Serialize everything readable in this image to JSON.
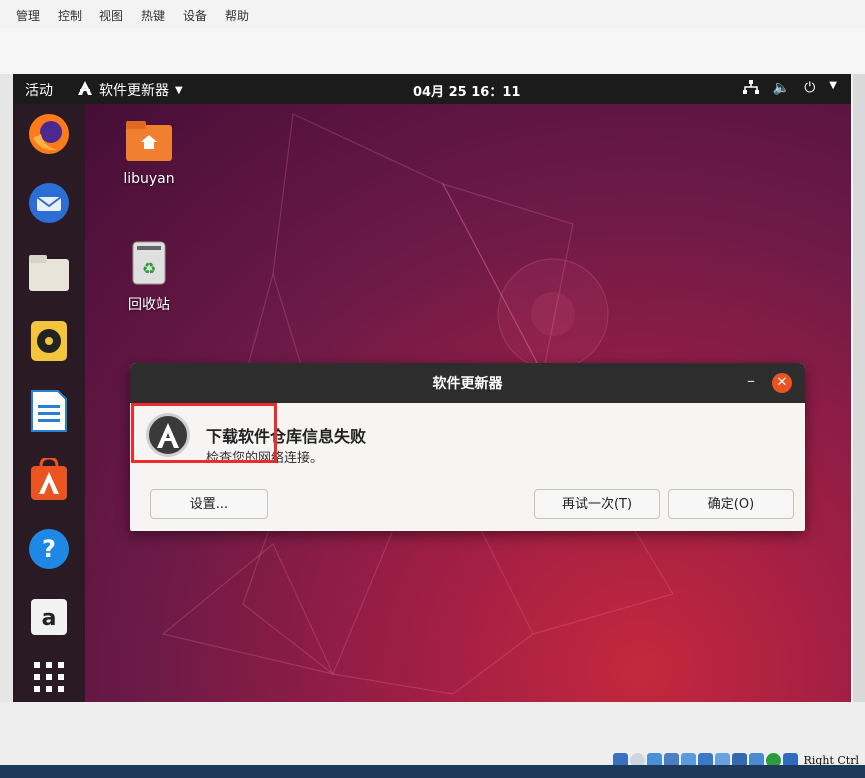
{
  "host": {
    "menu": [
      "管理",
      "控制",
      "视图",
      "热键",
      "设备",
      "帮助"
    ],
    "status_keys": "Right Ctrl"
  },
  "topbar": {
    "activities": "活动",
    "app_name": "软件更新器",
    "clock": "04月 25 16：11"
  },
  "desktop": {
    "home_label": "libuyan",
    "trash_label": "回收站"
  },
  "dock": [
    "firefox-icon",
    "thunderbird-icon",
    "files-icon",
    "rhythmbox-icon",
    "writer-icon",
    "software-center-icon",
    "help-icon",
    "amazon-icon",
    "app-grid-icon"
  ],
  "dialog": {
    "title": "软件更新器",
    "heading": "下载软件仓库信息失败",
    "message": "检查您的网络连接。",
    "settings_button": "设置...",
    "retry_button": "再试一次(T)",
    "ok_button": "确定(O)"
  },
  "colors": {
    "accent": "#e95420",
    "highlight": "#ee2a2a"
  }
}
